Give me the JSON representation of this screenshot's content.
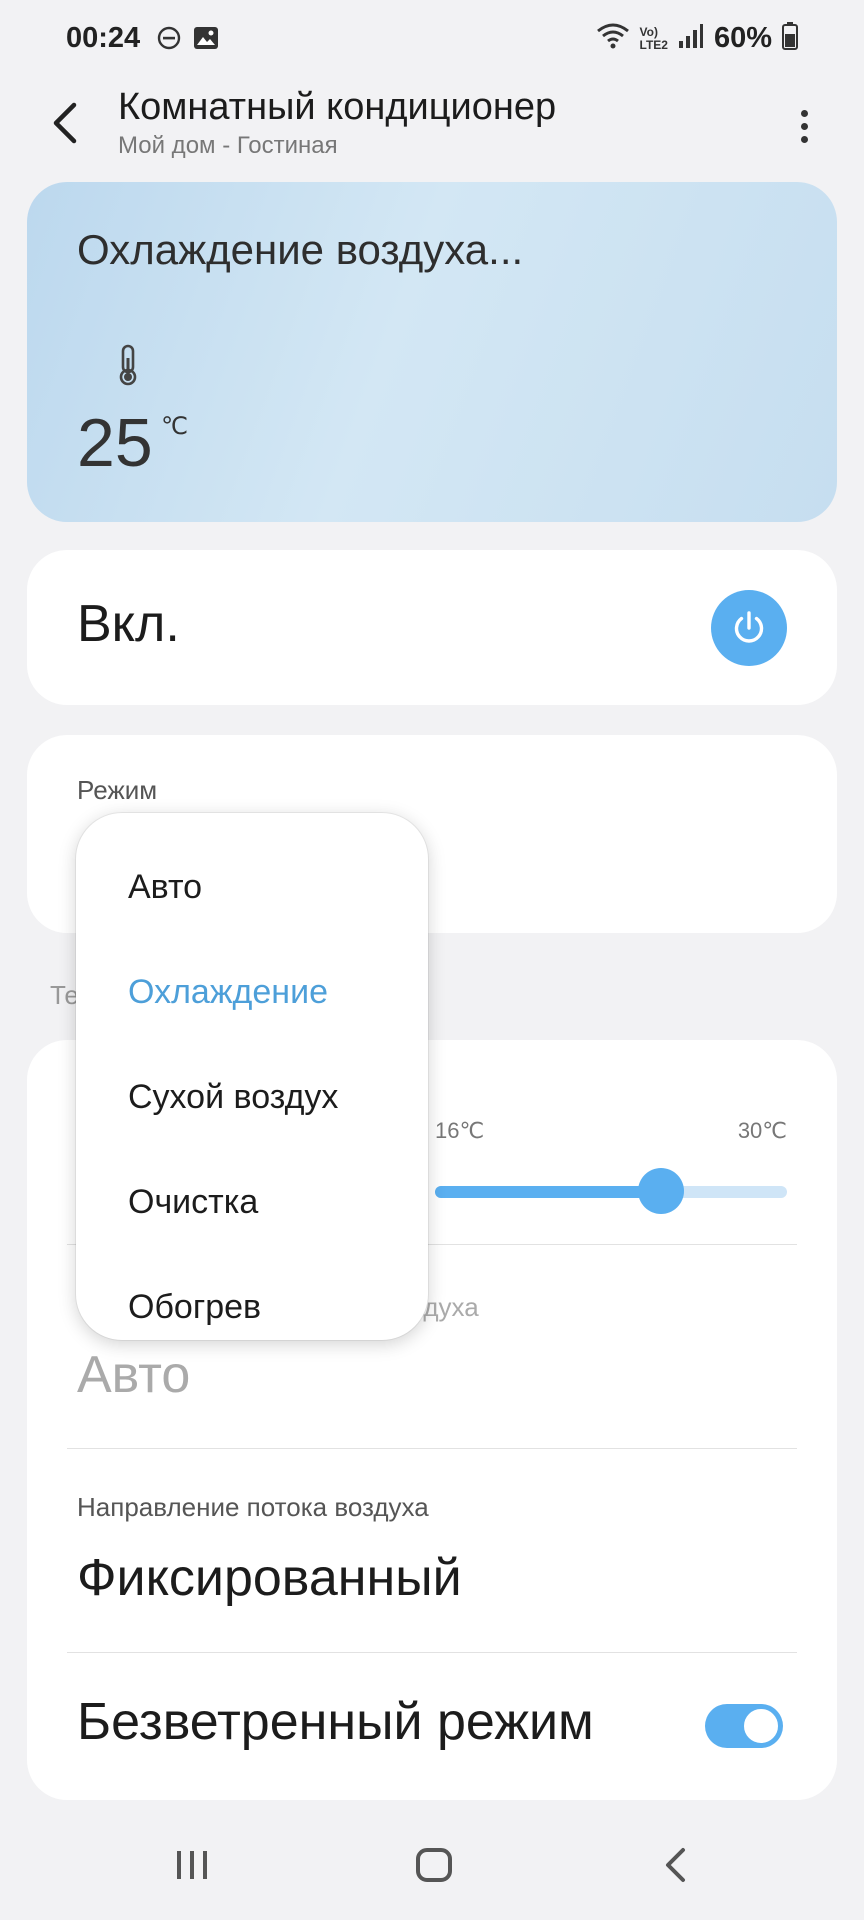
{
  "status_bar": {
    "time": "00:24",
    "battery": "60%",
    "network": "LTE2",
    "left_icons": [
      "do-not-disturb-icon",
      "gallery-icon"
    ],
    "right_icons": [
      "wifi-icon",
      "volte-icon",
      "signal-icon",
      "battery-icon"
    ]
  },
  "app_bar": {
    "title": "Комнатный кондиционер",
    "subtitle": "Мой дом - Гостиная"
  },
  "status_card": {
    "title": "Охлаждение воздуха...",
    "temperature": "25",
    "unit": "℃"
  },
  "power": {
    "label": "Вкл.",
    "on": true
  },
  "mode": {
    "label": "Режим",
    "options": [
      "Авто",
      "Охлаждение",
      "Сухой воздух",
      "Очистка",
      "Обогрев"
    ],
    "selected_index": 1
  },
  "section": {
    "label": "Те"
  },
  "temperature_slider": {
    "min_label": "16℃",
    "max_label": "30℃",
    "min": 16,
    "max": 30,
    "value": 25
  },
  "fan": {
    "label": "здуха",
    "value": "Авто"
  },
  "direction": {
    "label": "Направление потока воздуха",
    "value": "Фиксированный"
  },
  "windfree": {
    "label": "Безветренный режим",
    "enabled": true
  },
  "colors": {
    "accent": "#5aaff0",
    "selected_text": "#4d9fd9",
    "card_gradient_start": "#bcd8ee"
  }
}
